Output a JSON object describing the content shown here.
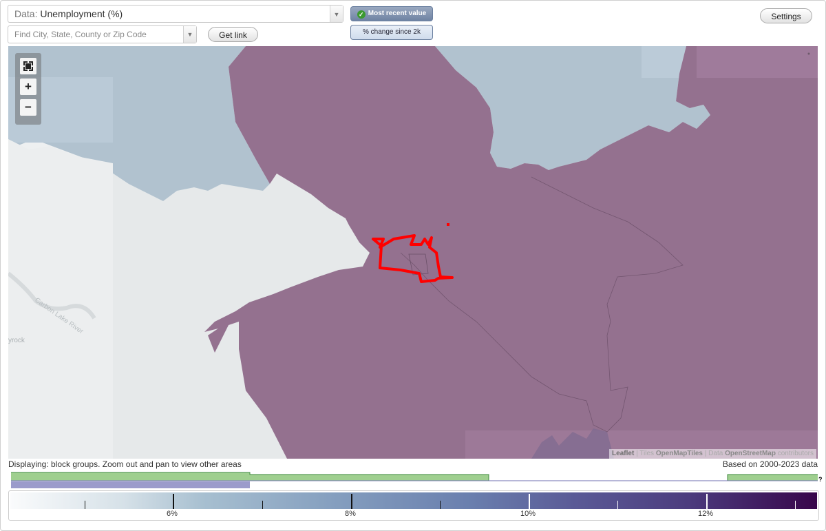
{
  "data_select": {
    "prefix": "Data:",
    "value": "Unemployment (%)"
  },
  "search": {
    "placeholder": "Find City, State, County or Zip Code"
  },
  "buttons": {
    "get_link": "Get link",
    "settings": "Settings",
    "most_recent": "Most recent value",
    "pct_change": "% change since 2k"
  },
  "map": {
    "labels": {
      "river": "Carbon Lake River",
      "town": "yrock"
    },
    "fills": {
      "purple": "#94718f",
      "blue": "#b1c2cf",
      "light_blue": "#bfcfdc",
      "base": "#e6e9ea",
      "highlight": "#ff0000"
    }
  },
  "attribution": {
    "leaflet": "Leaflet",
    "sep1": "|",
    "tiles_prefix": "Tiles",
    "tiles": "OpenMapTiles",
    "sep2": "|",
    "data_prefix": "Data",
    "data": "OpenStreetMap",
    "suffix": "contributors"
  },
  "footer": {
    "displaying": "Displaying: block groups. Zoom out and pan to view other areas",
    "based_on": "Based on 2000-2023 data",
    "help": "?"
  },
  "legend": {
    "labels": [
      "6%",
      "8%",
      "10%",
      "12%"
    ]
  },
  "colors": {
    "histogram_green": "#9fcf8f",
    "histogram_stroke": "#3c8a3c",
    "histogram_purple": "#9b9bcb"
  }
}
